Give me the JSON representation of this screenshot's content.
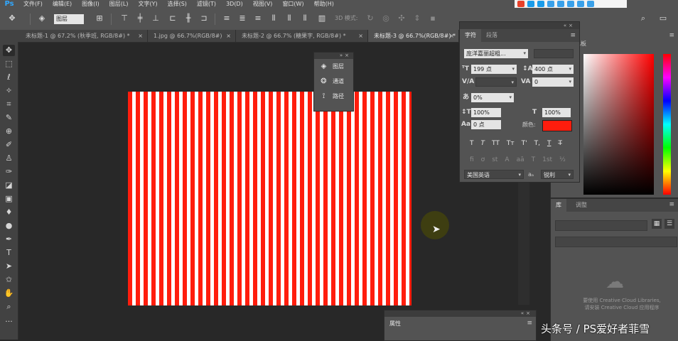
{
  "app": {
    "logo": "Ps"
  },
  "menu": [
    "文件(F)",
    "编辑(E)",
    "图像(I)",
    "图层(L)",
    "文字(Y)",
    "选择(S)",
    "滤镜(T)",
    "3D(D)",
    "视图(V)",
    "窗口(W)",
    "帮助(H)"
  ],
  "options": {
    "auto_select_value": "图层",
    "mode_3d_label": "3D 模式:"
  },
  "tabs": [
    {
      "label": "未标题-1 @ 67.2% (秋季班, RGB/8#) *",
      "close": "×"
    },
    {
      "label": "1.jpg @ 66.7%(RGB/8#)",
      "close": "×"
    },
    {
      "label": "未标题-2 @ 66.7% (糖果字, RGB/8#) *",
      "close": "×"
    },
    {
      "label": "未标题-3 @ 66.7%(RGB/8#) *",
      "close": "×"
    }
  ],
  "float_panel": {
    "items": [
      "图层",
      "通道",
      "路径"
    ]
  },
  "character_panel": {
    "tabs": [
      "字符",
      "段落"
    ],
    "font_family": "庞洋嘉丽超粗...",
    "font_size": "199 点",
    "leading": "400 点",
    "kerning": "",
    "tracking": "0",
    "tsume": "0%",
    "vertical_scale": "100%",
    "horizontal_scale": "100%",
    "baseline_shift": "0 点",
    "color_label": "颜色:",
    "color_value": "#ff1d0d",
    "style_buttons": [
      "T",
      "T",
      "TT",
      "Tт",
      "T'",
      "T,",
      "T",
      "T̶"
    ],
    "opentype_buttons": [
      "fi",
      "ơ",
      "st",
      "A",
      "aā",
      "T",
      "1st",
      "½"
    ],
    "language": "美国英语",
    "aa_label": "aₐ",
    "antialias": "锐利"
  },
  "color_panel": {
    "tab": "色板"
  },
  "libraries_panel": {
    "tabs": [
      "库",
      "调整"
    ],
    "message_line1": "要使用 Creative Cloud Libraries,",
    "message_line2": "请安装 Creative Cloud 应用程序"
  },
  "properties_panel": {
    "tab": "属性"
  },
  "watermark": "头条号 / PS爱好者菲雪"
}
